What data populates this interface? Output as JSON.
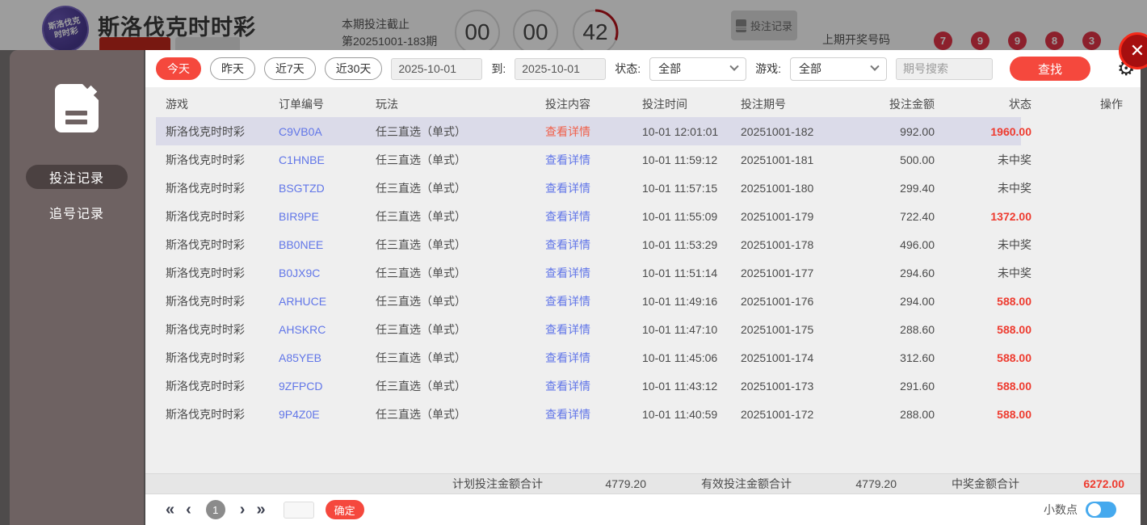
{
  "header": {
    "logo_line1": "斯洛伐克",
    "logo_line2": "时时彩",
    "title": "斯洛伐克时时彩",
    "deadline_label": "本期投注截止",
    "deadline_period": "第20251001-183期",
    "countdown": [
      "00",
      "00",
      "42"
    ],
    "bet_record_button": "投注记录",
    "last_draw_label": "上期开奖号码",
    "last_draw_numbers": [
      "7",
      "9",
      "9",
      "8",
      "3"
    ]
  },
  "sidebar": {
    "items": [
      {
        "label": "投注记录",
        "active": true
      },
      {
        "label": "追号记录",
        "active": false
      }
    ]
  },
  "filters": {
    "quick_ranges": [
      "今天",
      "昨天",
      "近7天",
      "近30天"
    ],
    "active_range": "今天",
    "date_from": "2025-10-01",
    "to_label": "到:",
    "date_to": "2025-10-01",
    "status_label": "状态:",
    "status_value": "全部",
    "game_label": "游戏:",
    "game_value": "全部",
    "search_placeholder": "期号搜索",
    "search_button": "查找"
  },
  "table": {
    "headers": [
      "游戏",
      "订单编号",
      "玩法",
      "投注内容",
      "投注时间",
      "投注期号",
      "投注金额",
      "状态",
      "操作"
    ],
    "detail_link": "查看详情",
    "rows": [
      {
        "game": "斯洛伐克时时彩",
        "order": "C9VB0A",
        "play": "任三直选（单式）",
        "time": "10-01 12:01:01",
        "period": "20251001-182",
        "amount": "992.00",
        "status": "1960.00",
        "win": true,
        "highlight": true
      },
      {
        "game": "斯洛伐克时时彩",
        "order": "C1HNBE",
        "play": "任三直选（单式）",
        "time": "10-01 11:59:12",
        "period": "20251001-181",
        "amount": "500.00",
        "status": "未中奖",
        "win": false,
        "highlight": false
      },
      {
        "game": "斯洛伐克时时彩",
        "order": "BSGTZD",
        "play": "任三直选（单式）",
        "time": "10-01 11:57:15",
        "period": "20251001-180",
        "amount": "299.40",
        "status": "未中奖",
        "win": false,
        "highlight": false
      },
      {
        "game": "斯洛伐克时时彩",
        "order": "BIR9PE",
        "play": "任三直选（单式）",
        "time": "10-01 11:55:09",
        "period": "20251001-179",
        "amount": "722.40",
        "status": "1372.00",
        "win": true,
        "highlight": false
      },
      {
        "game": "斯洛伐克时时彩",
        "order": "BB0NEE",
        "play": "任三直选（单式）",
        "time": "10-01 11:53:29",
        "period": "20251001-178",
        "amount": "496.00",
        "status": "未中奖",
        "win": false,
        "highlight": false
      },
      {
        "game": "斯洛伐克时时彩",
        "order": "B0JX9C",
        "play": "任三直选（单式）",
        "time": "10-01 11:51:14",
        "period": "20251001-177",
        "amount": "294.60",
        "status": "未中奖",
        "win": false,
        "highlight": false
      },
      {
        "game": "斯洛伐克时时彩",
        "order": "ARHUCE",
        "play": "任三直选（单式）",
        "time": "10-01 11:49:16",
        "period": "20251001-176",
        "amount": "294.00",
        "status": "588.00",
        "win": true,
        "highlight": false
      },
      {
        "game": "斯洛伐克时时彩",
        "order": "AHSKRC",
        "play": "任三直选（单式）",
        "time": "10-01 11:47:10",
        "period": "20251001-175",
        "amount": "288.60",
        "status": "588.00",
        "win": true,
        "highlight": false
      },
      {
        "game": "斯洛伐克时时彩",
        "order": "A85YEB",
        "play": "任三直选（单式）",
        "time": "10-01 11:45:06",
        "period": "20251001-174",
        "amount": "312.60",
        "status": "588.00",
        "win": true,
        "highlight": false
      },
      {
        "game": "斯洛伐克时时彩",
        "order": "9ZFPCD",
        "play": "任三直选（单式）",
        "time": "10-01 11:43:12",
        "period": "20251001-173",
        "amount": "291.60",
        "status": "588.00",
        "win": true,
        "highlight": false
      },
      {
        "game": "斯洛伐克时时彩",
        "order": "9P4Z0E",
        "play": "任三直选（单式）",
        "time": "10-01 11:40:59",
        "period": "20251001-172",
        "amount": "288.00",
        "status": "588.00",
        "win": true,
        "highlight": false
      }
    ]
  },
  "totals": {
    "plan_label": "计划投注金额合计",
    "plan_value": "4779.20",
    "valid_label": "有效投注金额合计",
    "valid_value": "4779.20",
    "win_label": "中奖金额合计",
    "win_value": "6272.00"
  },
  "pagination": {
    "current_page": "1",
    "confirm_button": "确定",
    "decimal_label": "小数点"
  },
  "colors": {
    "accent_red": "#f5483d",
    "link_blue": "#6176e8",
    "win_red": "#ee3b2f",
    "toggle_blue": "#45a9ee",
    "sidebar_bg": "#6e6262",
    "highlight_row": "#dbdbe9"
  }
}
